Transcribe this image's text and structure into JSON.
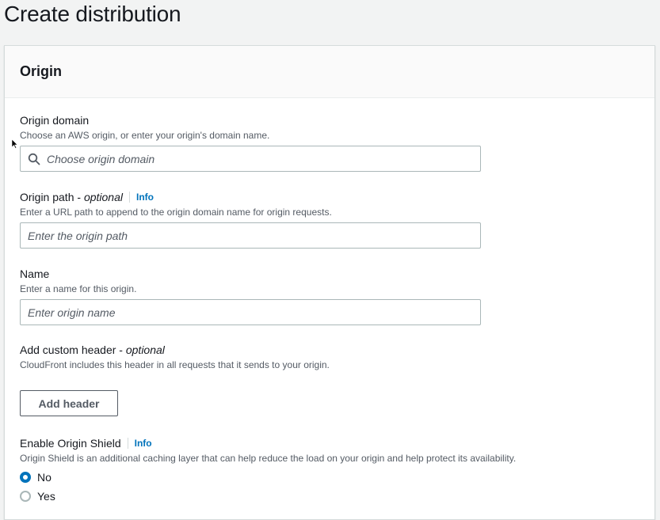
{
  "page": {
    "title": "Create distribution"
  },
  "origin_section": {
    "title": "Origin",
    "origin_domain": {
      "label": "Origin domain",
      "description": "Choose an AWS origin, or enter your origin's domain name.",
      "placeholder": "Choose origin domain",
      "icon": "search-icon"
    },
    "origin_path": {
      "label": "Origin path - ",
      "label_optional": "optional",
      "info": "Info",
      "description": "Enter a URL path to append to the origin domain name for origin requests.",
      "placeholder": "Enter the origin path"
    },
    "name": {
      "label": "Name",
      "description": "Enter a name for this origin.",
      "placeholder": "Enter origin name"
    },
    "custom_header": {
      "label": "Add custom header - ",
      "label_optional": "optional",
      "description": "CloudFront includes this header in all requests that it sends to your origin.",
      "button_label": "Add header"
    },
    "origin_shield": {
      "label": "Enable Origin Shield",
      "info": "Info",
      "description": "Origin Shield is an additional caching layer that can help reduce the load on your origin and help protect its availability.",
      "options": [
        {
          "label": "No",
          "selected": true
        },
        {
          "label": "Yes",
          "selected": false
        }
      ]
    }
  },
  "colors": {
    "accent": "#0073bb",
    "text": "#16191f",
    "secondary_text": "#545b64",
    "background": "#f2f3f3"
  }
}
